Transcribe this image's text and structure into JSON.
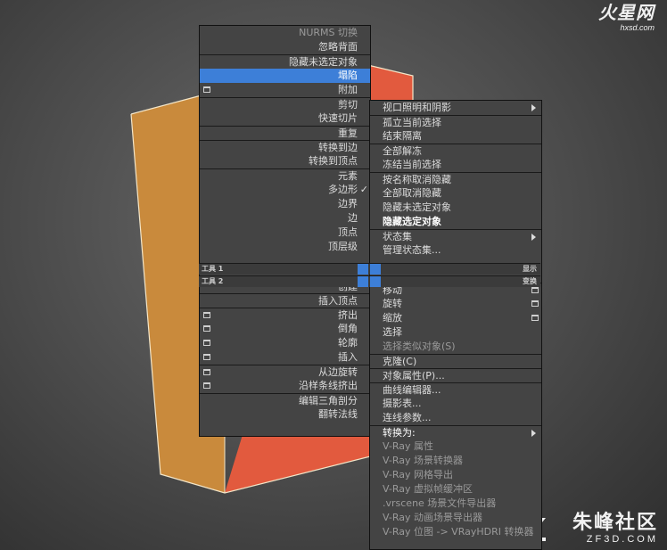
{
  "watermarks": {
    "top_main": "火星网",
    "top_sub": "hxsd.com",
    "bottom_main": "朱峰社区",
    "bottom_sub": "ZF3D.COM"
  },
  "colors": {
    "box_side": "#c98a3c",
    "box_front": "#e25a3e",
    "highlight": "#3d7fd8",
    "menu_bg": "#444444"
  },
  "left_menu": {
    "items": [
      {
        "label": "NURMS 切换",
        "style": "dim"
      },
      {
        "label": "忽略背面",
        "style": ""
      },
      {
        "label": "隐藏未选定对象",
        "style": "",
        "sep": true
      },
      {
        "label": "塌陷",
        "style": "hl"
      },
      {
        "label": "附加",
        "style": "",
        "icon": true
      },
      {
        "label": "剪切",
        "style": "",
        "sep": true
      },
      {
        "label": "快速切片",
        "style": ""
      },
      {
        "label": "重复",
        "style": "",
        "sep": true
      },
      {
        "label": "转换到边",
        "style": "",
        "sep": true
      },
      {
        "label": "转换到顶点",
        "style": ""
      },
      {
        "label": "元素",
        "style": "",
        "sep": true
      },
      {
        "label": "多边形",
        "style": "",
        "tick": "✓"
      },
      {
        "label": "边界",
        "style": ""
      },
      {
        "label": "边",
        "style": ""
      },
      {
        "label": "顶点",
        "style": ""
      },
      {
        "label": "顶层级",
        "style": ""
      }
    ],
    "items2": [
      {
        "label": "创建",
        "style": "",
        "sep": true
      },
      {
        "label": "插入顶点",
        "style": "",
        "sep": true
      },
      {
        "label": "挤出",
        "style": "",
        "icon": true,
        "sep": true
      },
      {
        "label": "倒角",
        "style": "",
        "icon": true
      },
      {
        "label": "轮廓",
        "style": "",
        "icon": true
      },
      {
        "label": "插入",
        "style": "",
        "icon": true
      },
      {
        "label": "从边旋转",
        "style": "",
        "icon": true,
        "sep": true
      },
      {
        "label": "沿样条线挤出",
        "style": "",
        "icon": true
      },
      {
        "label": "编辑三角剖分",
        "style": "",
        "sep": true
      },
      {
        "label": "翻转法线",
        "style": ""
      }
    ]
  },
  "toolbars": {
    "tools1": "工具 1",
    "display": "显示",
    "tools2": "工具 2",
    "transform": "变换"
  },
  "right_menu": {
    "items": [
      {
        "label": "视口照明和阴影",
        "style": "",
        "arrow": true
      },
      {
        "label": "孤立当前选择",
        "style": "",
        "sep": true
      },
      {
        "label": "结束隔离",
        "style": ""
      },
      {
        "label": "全部解冻",
        "style": "",
        "sep": true
      },
      {
        "label": "冻结当前选择",
        "style": ""
      },
      {
        "label": "按名称取消隐藏",
        "style": "",
        "sep": true
      },
      {
        "label": "全部取消隐藏",
        "style": ""
      },
      {
        "label": "隐藏未选定对象",
        "style": ""
      },
      {
        "label": "隐藏选定对象",
        "style": "bold"
      },
      {
        "label": "状态集",
        "style": "",
        "arrow": true,
        "sep": true
      },
      {
        "label": "管理状态集...",
        "style": ""
      }
    ],
    "items2": [
      {
        "label": "移动",
        "style": "",
        "icon": true,
        "sep": true
      },
      {
        "label": "旋转",
        "style": "",
        "icon": true
      },
      {
        "label": "缩放",
        "style": "",
        "icon": true
      },
      {
        "label": "选择",
        "style": ""
      },
      {
        "label": "选择类似对象(S)",
        "style": "dim"
      },
      {
        "label": "克隆(C)",
        "style": "",
        "sep": true
      },
      {
        "label": "对象属性(P)...",
        "style": "",
        "sep": true
      },
      {
        "label": "曲线编辑器...",
        "style": "",
        "sep": true
      },
      {
        "label": "摄影表...",
        "style": ""
      },
      {
        "label": "连线参数...",
        "style": ""
      },
      {
        "label": "转换为:",
        "style": "bright",
        "arrow": true,
        "sep": true
      },
      {
        "label": "V-Ray 属性",
        "style": "dim"
      },
      {
        "label": "V-Ray 场景转换器",
        "style": "dim"
      },
      {
        "label": "V-Ray 网格导出",
        "style": "dim"
      },
      {
        "label": "V-Ray 虚拟帧缓冲区",
        "style": "dim"
      },
      {
        "label": ".vrscene 场景文件导出器",
        "style": "dim"
      },
      {
        "label": "V-Ray 动画场景导出器",
        "style": "dim"
      },
      {
        "label": "V-Ray 位图 -> VRayHDRI 转换器",
        "style": "dim"
      }
    ]
  }
}
